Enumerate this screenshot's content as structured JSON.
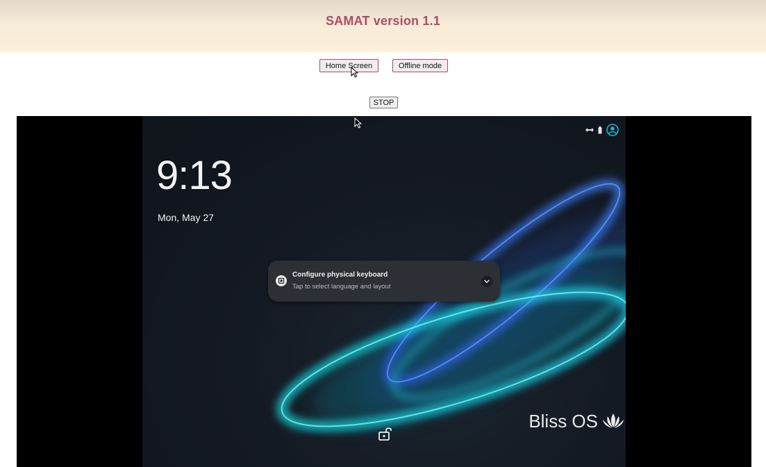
{
  "header": {
    "title": "SAMAT version 1.1"
  },
  "controls": {
    "home_label": "Home Screen",
    "offline_label": "Offline mode",
    "stop_label": "STOP"
  },
  "device": {
    "clock": "9:13",
    "date": "Mon, May 27",
    "status_icons": [
      "connectivity-arrows-icon",
      "battery-icon",
      "account-icon"
    ],
    "notification": {
      "title": "Configure physical keyboard",
      "subtitle": "Tap to select language and layout"
    },
    "brand": "Bliss OS",
    "brand_logo": "lotus-logo-icon",
    "lock_icon": "unlock-icon"
  },
  "colors": {
    "title": "#b14a66",
    "button_border": "#b04765",
    "device_bg": "#141a23",
    "accent": "#1fb2d6"
  }
}
